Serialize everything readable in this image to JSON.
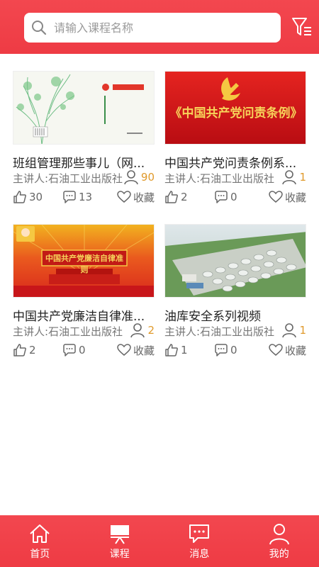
{
  "search": {
    "placeholder": "请输入课程名称"
  },
  "courses": [
    {
      "title": "班组管理那些事儿（网...",
      "lecturer": "主讲人:石油工业出版社",
      "views": "90",
      "likes": "30",
      "comments": "13",
      "fav_label": "收藏",
      "thumb_icon": "book-cover"
    },
    {
      "title": "中国共产党问责条例系...",
      "lecturer": "主讲人:石油工业出版社",
      "views": "1",
      "likes": "2",
      "comments": "0",
      "fav_label": "收藏",
      "thumb_icon": "party-emblem",
      "thumb_text": "《中国共产党问责条例》"
    },
    {
      "title": "中国共产党廉洁自律准...",
      "lecturer": "主讲人:石油工业出版社",
      "views": "2",
      "likes": "2",
      "comments": "0",
      "fav_label": "收藏",
      "thumb_icon": "tiananmen-banner",
      "thumb_text": "中国共产党廉洁自律准则"
    },
    {
      "title": "油库安全系列视频",
      "lecturer": "主讲人:石油工业出版社",
      "views": "1",
      "likes": "1",
      "comments": "0",
      "fav_label": "收藏",
      "thumb_icon": "oil-depot-aerial"
    }
  ],
  "tabs": [
    {
      "label": "首页",
      "icon": "home-icon"
    },
    {
      "label": "课程",
      "icon": "course-icon",
      "active": true
    },
    {
      "label": "消息",
      "icon": "message-icon"
    },
    {
      "label": "我的",
      "icon": "user-icon"
    }
  ],
  "colors": {
    "brand_red": "#ee3b44",
    "views_orange": "#e09a2c"
  }
}
